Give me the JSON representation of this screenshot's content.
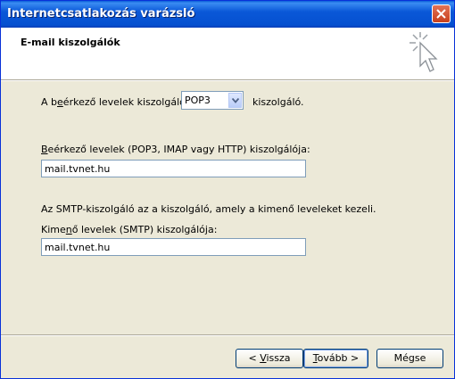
{
  "window": {
    "title": "Internetcsatlakozás varázsló"
  },
  "header": {
    "title": "E-mail kiszolgálók",
    "icon": "wizard-cursor-icon"
  },
  "incoming_type": {
    "prefix_pre": "A b",
    "prefix_u": "e",
    "prefix_post": "érkező levelek kiszolgálója",
    "selected": "POP3",
    "suffix": "kiszolgáló."
  },
  "incoming_server": {
    "label_u": "B",
    "label_rest": "eérkező levelek (POP3, IMAP vagy HTTP) kiszolgálója:",
    "value": "mail.tvnet.hu"
  },
  "smtp": {
    "description": "Az SMTP-kiszolgáló az a kiszolgáló, amely a kimenő leveleket kezeli.",
    "label_pre": "Kime",
    "label_u": "n",
    "label_post": "ő levelek (SMTP) kiszolgálója:",
    "value": "mail.tvnet.hu"
  },
  "buttons": {
    "back": {
      "pre": "< ",
      "u": "V",
      "post": "issza"
    },
    "next": {
      "u": "T",
      "post": "ovább >"
    },
    "cancel": "Mégse"
  }
}
